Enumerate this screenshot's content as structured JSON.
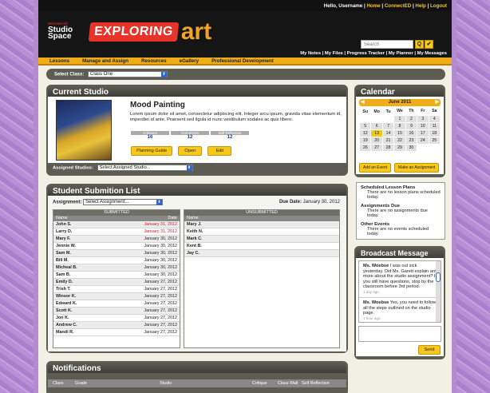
{
  "topbar": {
    "greeting": "Hello, Username",
    "home": "Home",
    "connected": "ConnectED",
    "help": "Help",
    "logout": "Logout",
    "sep": "|"
  },
  "logo": {
    "publisher": "McGraw-Hill",
    "line1": "Studio",
    "line2": "Space"
  },
  "brand": {
    "word1": "EXPLORING",
    "word2": "art"
  },
  "search": {
    "placeholder": "Search",
    "go": "Q",
    "check": "✔"
  },
  "header_links": "My Notes  |  My Files  |  Progress Tracker  |  My Planner  |  My Messages",
  "nav": [
    "Lessons",
    "Manage and Assign",
    "Resources",
    "eGallery",
    "Professional Development"
  ],
  "select_class": {
    "label": "Select Class:",
    "value": "Class One"
  },
  "studio": {
    "title": "Current Studio",
    "name": "Mood Painting",
    "desc": "Lorem ipsum dolor sit amet, consectetur adipiscing elit. Integer arcu ipsum, gravida vitae elementum id, imperdiet id ante. Praesent sed ligula id nunc vestibulum sodales ac quis libero.",
    "stats": [
      {
        "label": "Critiques",
        "value": "16"
      },
      {
        "label": "Comments",
        "value": "12"
      },
      {
        "label": "Self Reflection",
        "value": "12"
      }
    ],
    "buttons": {
      "guide": "Planning Guide",
      "open": "Open",
      "edit": "Edit"
    },
    "assigned_label": "Assigned Studios:",
    "assigned_value": "Select Assigned Studio..."
  },
  "submissions": {
    "title": "Student Submition List",
    "assign_label": "Assignment:",
    "assign_value": "Select Assignment...",
    "due_label": "Due Date:",
    "due_value": "January 30, 2012",
    "submitted_hdr": "SUBMITTED",
    "unsubmitted_hdr": "UNSUBMITTED",
    "col_name": "Name",
    "col_date": "Date",
    "submitted": [
      [
        "John S.",
        "January 31, 2012",
        1
      ],
      [
        "Larry D.",
        "January 31, 2012",
        1
      ],
      [
        "Mary F.",
        "January 30, 2012",
        0
      ],
      [
        "Jennie W.",
        "January 30, 2012",
        0
      ],
      [
        "Sam M.",
        "January 30, 2012",
        0
      ],
      [
        "Bill M.",
        "January 30, 2012",
        0
      ],
      [
        "Micheal B.",
        "January 30, 2012",
        0
      ],
      [
        "Sam B.",
        "January 30, 2012",
        0
      ],
      [
        "Emily D.",
        "January 27, 2012",
        0
      ],
      [
        "Trish T.",
        "January 27, 2012",
        0
      ],
      [
        "Winsor K.",
        "January 27, 2012",
        0
      ],
      [
        "Edward K.",
        "January 27, 2012",
        0
      ],
      [
        "Scott K.",
        "January 27, 2012",
        0
      ],
      [
        "Jon K.",
        "January 27, 2012",
        0
      ],
      [
        "Andrew C.",
        "January 27, 2012",
        0
      ],
      [
        "Mandi R.",
        "January 27, 2012",
        0
      ]
    ],
    "unsubmitted": [
      "Mary J.",
      "Keith N.",
      "Mark C.",
      "Kent B.",
      "Jay C."
    ]
  },
  "notifications": {
    "title": "Notifications",
    "cols": [
      "Class",
      "Grade",
      "Studio",
      "Critique",
      "Class Wall",
      "Self Reflection"
    ]
  },
  "calendar": {
    "title": "Calendar",
    "month": "June 2011",
    "prev": "◀",
    "next": "▶",
    "days": [
      "Su",
      "Mo",
      "Tu",
      "We",
      "Th",
      "Fr",
      "Sa"
    ],
    "weeks": [
      [
        "",
        "",
        "",
        "1",
        "2",
        "3",
        "4"
      ],
      [
        "5",
        "6",
        "7",
        "8",
        "9",
        "10",
        "11"
      ],
      [
        "12",
        "13",
        "14",
        "15",
        "16",
        "17",
        "18"
      ],
      [
        "19",
        "20",
        "21",
        "22",
        "23",
        "24",
        "25"
      ],
      [
        "26",
        "27",
        "28",
        "29",
        "30",
        "",
        ""
      ]
    ],
    "today": "13",
    "add_event": "Add an Event",
    "make_assignment": "Make an Assignment",
    "sections": [
      {
        "head": "Scheduled Lesson Plans",
        "text": "There are no lesson plans scheduled today."
      },
      {
        "head": "Assignments Due",
        "text": "There are no assignments due today."
      },
      {
        "head": "Other Events",
        "text": "There are no events scheduled today."
      }
    ]
  },
  "broadcast": {
    "title": "Broadcast Message",
    "messages": [
      {
        "from": "Ms. Woebse",
        "text": "I was out sick yesterday. Did Ms. Garett explain any more about the studio assignment? If you still have questions, stop by the classroom before 3rd period.",
        "time": "1 day ago"
      },
      {
        "from": "Ms. Woebse",
        "text": "Yes, you need to follow all the steps outlined on the studio page.",
        "time": "1 hour ago"
      }
    ],
    "send": "Send"
  }
}
